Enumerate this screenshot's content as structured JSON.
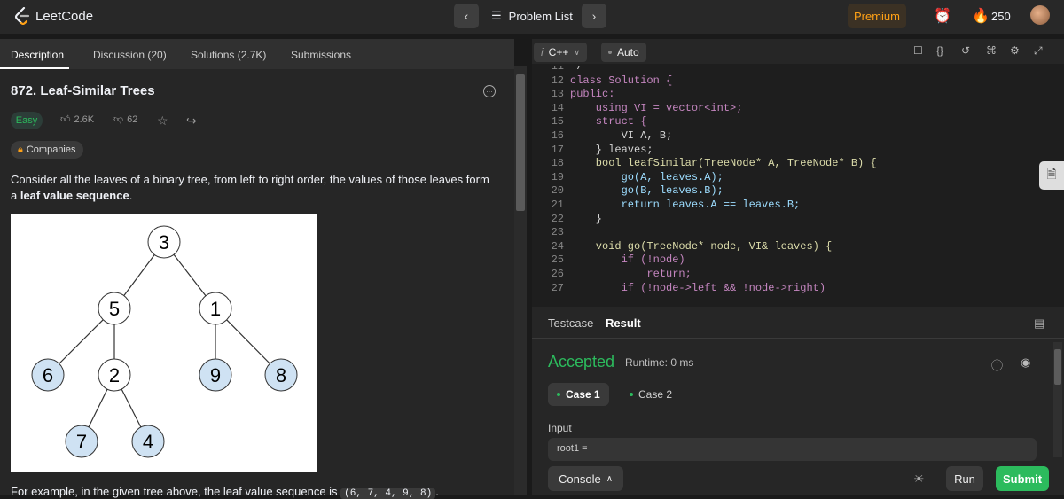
{
  "nav": {
    "logo_text": "LeetCode",
    "problem_list": "Problem List",
    "premium": "Premium",
    "streak": "250"
  },
  "left_tabs": [
    {
      "label": "Description"
    },
    {
      "label": "Discussion (20)"
    },
    {
      "label": "Solutions (2.7K)"
    },
    {
      "label": "Submissions"
    }
  ],
  "problem": {
    "title": "872. Leaf-Similar Trees",
    "difficulty": "Easy",
    "likes": "2.6K",
    "dislikes": "62",
    "companies": "Companies",
    "desc_1": "Consider all the leaves of a binary tree, from left to right order, the values of those leaves form a ",
    "desc_bold": "leaf value sequence",
    "desc_end": ".",
    "example_text": "For example, in the given tree above, the leaf value sequence is ",
    "example_seq": "(6, 7, 4, 9, 8)",
    "example_end": "."
  },
  "tree_nodes": [
    "3",
    "5",
    "1",
    "6",
    "2",
    "9",
    "8",
    "7",
    "4"
  ],
  "editor": {
    "language": "C++",
    "auto": "Auto",
    "first_line": "*/",
    "lines": [
      {
        "n": "11",
        "text": "*/"
      },
      {
        "n": "12",
        "text": "class Solution {"
      },
      {
        "n": "13",
        "text": "public:"
      },
      {
        "n": "14",
        "text": "    using VI = vector<int>;"
      },
      {
        "n": "15",
        "text": "    struct {"
      },
      {
        "n": "16",
        "text": "        VI A, B;"
      },
      {
        "n": "17",
        "text": "    } leaves;"
      },
      {
        "n": "18",
        "text": "    bool leafSimilar(TreeNode* A, TreeNode* B) {"
      },
      {
        "n": "19",
        "text": "        go(A, leaves.A);"
      },
      {
        "n": "20",
        "text": "        go(B, leaves.B);"
      },
      {
        "n": "21",
        "text": "        return leaves.A == leaves.B;"
      },
      {
        "n": "22",
        "text": "    }"
      },
      {
        "n": "23",
        "text": ""
      },
      {
        "n": "24",
        "text": "    void go(TreeNode* node, VI& leaves) {"
      },
      {
        "n": "25",
        "text": "        if (!node)"
      },
      {
        "n": "26",
        "text": "            return;"
      },
      {
        "n": "27",
        "text": "        if (!node->left && !node->right)"
      }
    ]
  },
  "console": {
    "tab_testcase": "Testcase",
    "tab_result": "Result",
    "status": "Accepted",
    "runtime": "Runtime: 0 ms",
    "case1": "Case 1",
    "case2": "Case 2",
    "input_label": "Input",
    "input_value": "root1 =",
    "console_btn": "Console",
    "run": "Run",
    "submit": "Submit"
  },
  "colors": {
    "accent": "#ffa116",
    "success": "#2cbb5d"
  }
}
